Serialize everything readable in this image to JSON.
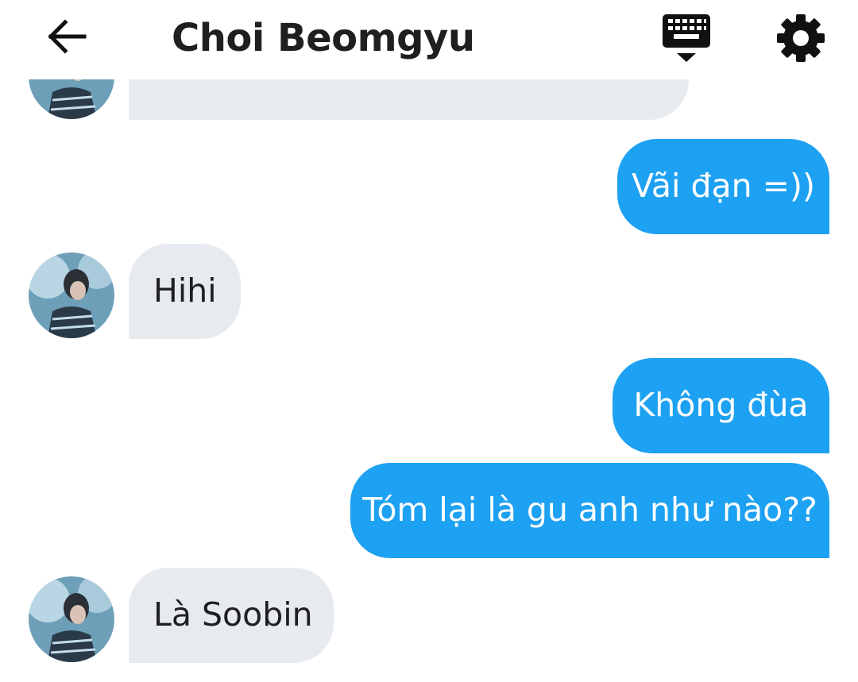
{
  "header": {
    "title": "Choi Beomgyu",
    "back_icon": "arrow-left-icon",
    "keyboard_icon": "keyboard-hide-icon",
    "settings_icon": "gear-icon"
  },
  "colors": {
    "outgoing_bubble": "#1da1f2",
    "incoming_bubble": "#e7ebef",
    "text_dark": "#1f1f1f",
    "text_light": "#ffffff"
  },
  "messages": [
    {
      "direction": "incoming",
      "text": ""
    },
    {
      "direction": "outgoing",
      "text": "Vãi đạn =))"
    },
    {
      "direction": "incoming",
      "text": "Hihi"
    },
    {
      "direction": "outgoing",
      "text": "Không đùa"
    },
    {
      "direction": "outgoing",
      "text": "Tóm lại là gu anh như nào??"
    },
    {
      "direction": "incoming",
      "text": "Là Soobin"
    }
  ]
}
